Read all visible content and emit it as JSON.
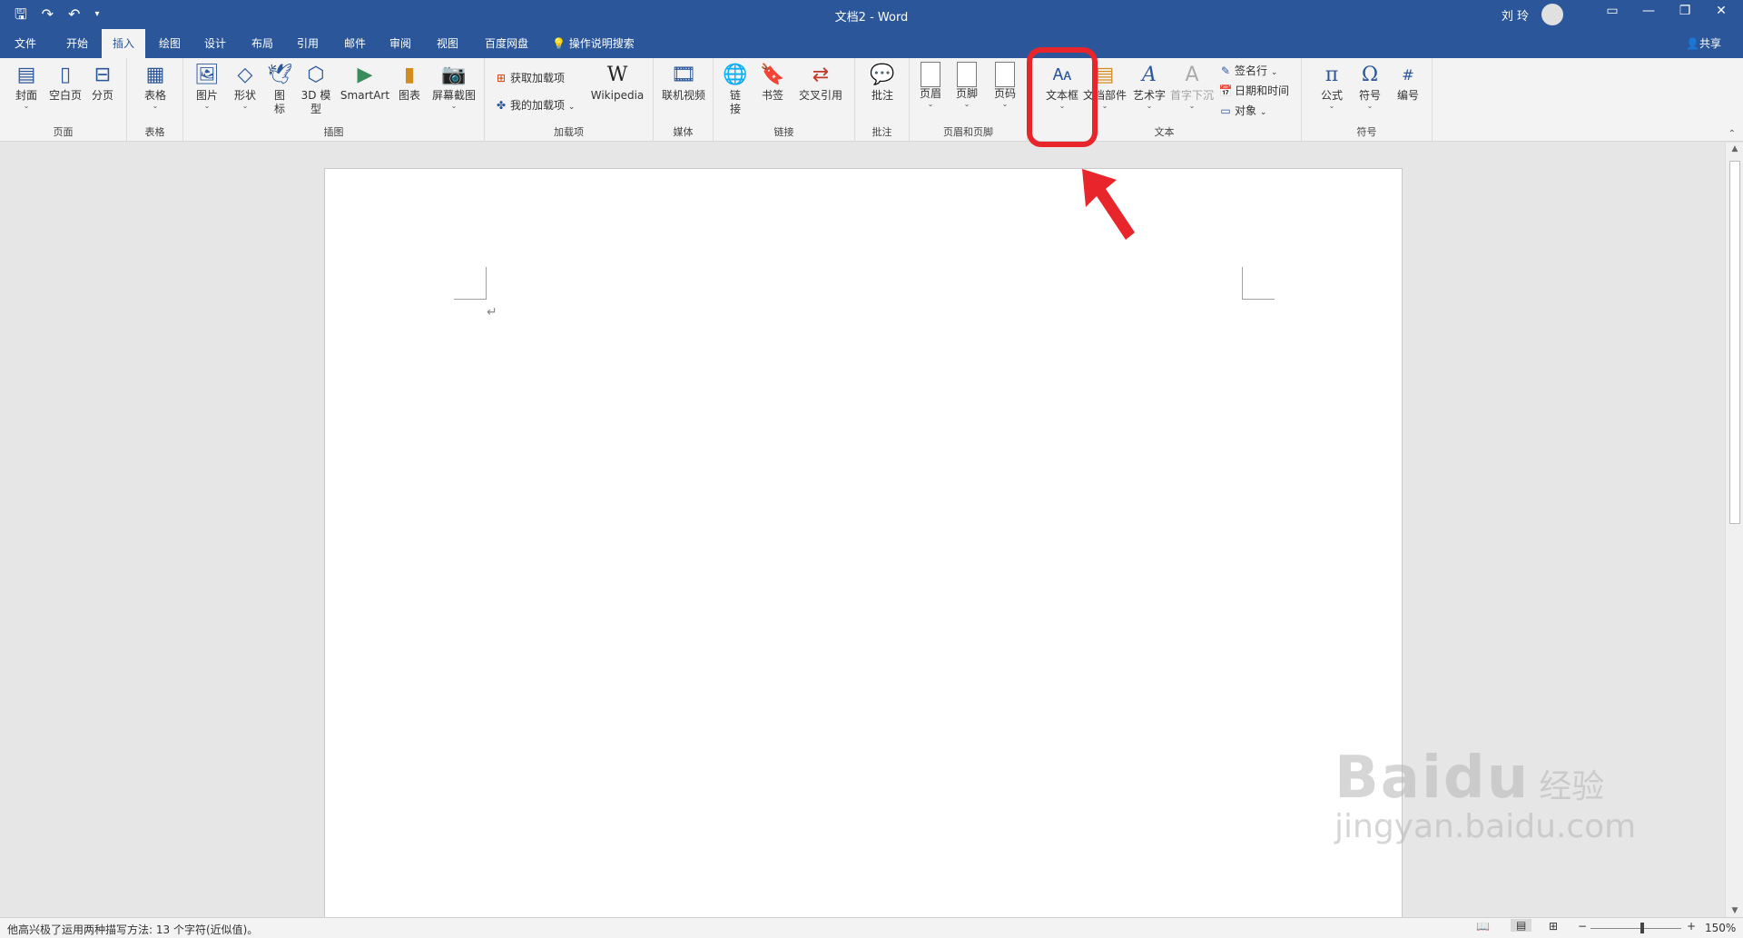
{
  "window": {
    "title": "文档2  -  Word",
    "user": "刘 玲"
  },
  "tabs": [
    "文件",
    "开始",
    "插入",
    "绘图",
    "设计",
    "布局",
    "引用",
    "邮件",
    "审阅",
    "视图",
    "百度网盘"
  ],
  "active_tab": "插入",
  "tell_me": "操作说明搜索",
  "share": "共享",
  "ribbon": {
    "pages": {
      "label": "页面",
      "cover": "封面",
      "blank": "空白页",
      "break": "分页"
    },
    "tables": {
      "label": "表格",
      "table": "表格"
    },
    "illustrations": {
      "label": "插图",
      "picture": "图片",
      "shapes": "形状",
      "icons": "图标",
      "model3d": "3D 模型",
      "smartart": "SmartArt",
      "chart": "图表",
      "screenshot": "屏幕截图"
    },
    "addins": {
      "label": "加载项",
      "get": "获取加载项",
      "my": "我的加载项",
      "wiki": "Wikipedia"
    },
    "media": {
      "label": "媒体",
      "video": "联机视频"
    },
    "links": {
      "label": "链接",
      "link": "链接",
      "bookmark": "书签",
      "crossref": "交叉引用"
    },
    "comments": {
      "label": "批注",
      "comment": "批注"
    },
    "header_footer": {
      "label": "页眉和页脚",
      "header": "页眉",
      "footer": "页脚",
      "page_number": "页码"
    },
    "text": {
      "label": "文本",
      "textbox": "文本框",
      "parts": "文档部件",
      "wordart": "艺术字",
      "dropcap": "首字下沉",
      "signature": "签名行",
      "datetime": "日期和时间",
      "object": "对象"
    },
    "symbols": {
      "label": "符号",
      "equation": "公式",
      "symbol": "符号",
      "number": "编号"
    }
  },
  "status": {
    "text": "他高兴极了运用两种描写方法: 13 个字符(近似值)。",
    "zoom": "150%"
  },
  "watermark": {
    "brand": "Baidu",
    "brand_cn": "经验",
    "url": "jingyan.baidu.com"
  },
  "colors": {
    "accent": "#2b579a",
    "highlight": "#e8252a"
  }
}
